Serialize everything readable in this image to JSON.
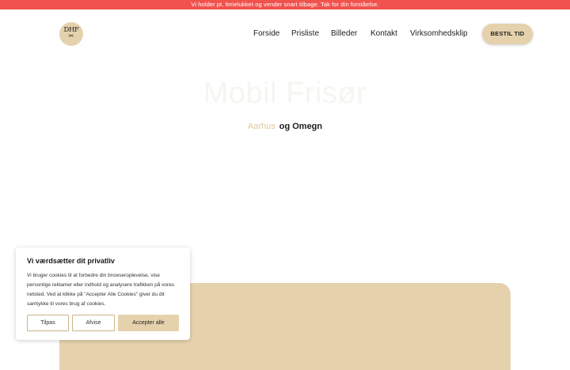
{
  "announcement": {
    "text": "Vi holder pt. ferielukket og vender snart tilbage. Tak for din forståelse."
  },
  "logo": {
    "text": "DHF",
    "icon": "scissors-icon"
  },
  "nav": {
    "items": [
      {
        "label": "Forside"
      },
      {
        "label": "Prisliste"
      },
      {
        "label": "Billeder"
      },
      {
        "label": "Kontakt"
      },
      {
        "label": "Virksomhedsklip"
      }
    ],
    "cta_label": "BESTIL TID"
  },
  "hero": {
    "title": "Mobil Frisør",
    "subtitle_accent": "Aarhus",
    "subtitle_rest": "og Omegn"
  },
  "cookie": {
    "title": "Vi værdsætter dit privatliv",
    "text": "Vi bruger cookies til at forbedre din browseroplevelse, vise personlige reklamer eller indhold og analysere trafikken på vores netsted. Ved at klikke på \"Accepter Alle Cookies\" giver du dit samtykke til vores brug af cookies.",
    "customize_label": "Tilpas",
    "reject_label": "Afvise",
    "accept_label": "Accepter alle"
  },
  "colors": {
    "announcement_bg": "#f0534e",
    "accent": "#e5d2ad",
    "accent_text": "#e3c898"
  }
}
